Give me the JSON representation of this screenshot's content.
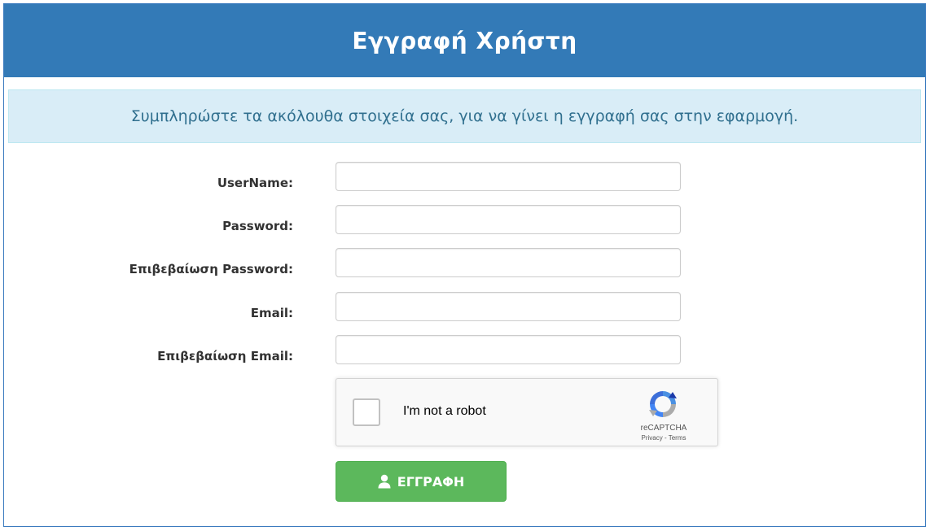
{
  "header": {
    "title": "Εγγραφή Χρήστη"
  },
  "info": {
    "message": "Συμπληρώστε τα ακόλουθα στοιχεία σας, για να γίνει η εγγραφή σας στην εφαρμογή."
  },
  "form": {
    "fields": [
      {
        "label": "UserName:",
        "value": "",
        "placeholder": ""
      },
      {
        "label": "Password:",
        "value": "",
        "placeholder": ""
      },
      {
        "label": "Επιβεβαίωση Password:",
        "value": "",
        "placeholder": ""
      },
      {
        "label": "Email:",
        "value": "",
        "placeholder": ""
      },
      {
        "label": "Επιβεβαίωση Email:",
        "value": "",
        "placeholder": ""
      }
    ]
  },
  "recaptcha": {
    "label": "I'm not a robot",
    "brand": "reCAPTCHA",
    "privacy": "Privacy",
    "separator": " - ",
    "terms": "Terms",
    "checked": false,
    "icon": "recaptcha-logo-icon"
  },
  "submit": {
    "label": "ΕΓΓΡΑΦΗ",
    "icon": "user-icon"
  },
  "colors": {
    "header_bg": "#337ab7",
    "info_bg": "#d9edf7",
    "info_text": "#31708f",
    "button_bg": "#5cb85c"
  }
}
